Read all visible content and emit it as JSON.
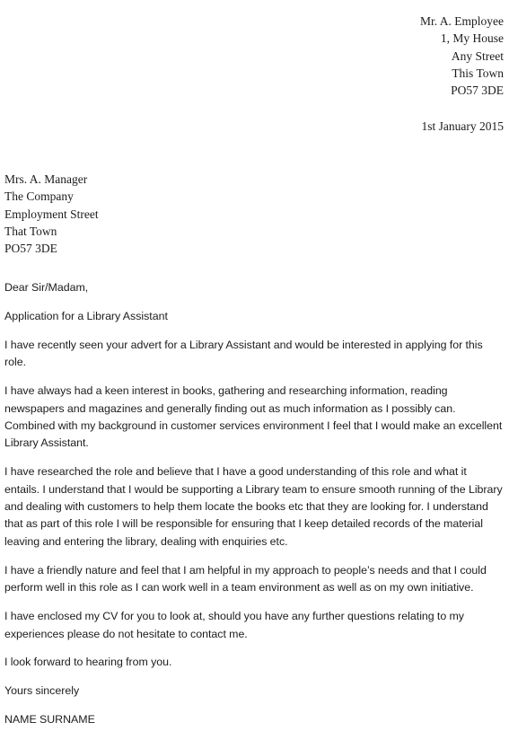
{
  "document": {
    "type": "cover-letter",
    "background_color": "#ffffff",
    "text_color": "#1c1c1c",
    "sender": {
      "lines": [
        "Mr. A. Employee",
        "1, My House",
        "Any Street",
        "This Town",
        "PO57 3DE"
      ]
    },
    "date": "1st January 2015",
    "recipient": {
      "lines": [
        "Mrs. A. Manager",
        "The Company",
        "Employment Street",
        "That Town",
        "PO57 3DE"
      ]
    },
    "salutation": "Dear Sir/Madam,",
    "subject": "Application for a Library Assistant",
    "paragraphs": [
      "I have recently seen your advert for a Library Assistant and would be interested in applying for this role.",
      "I have always had a keen interest in books, gathering and researching information, reading newspapers and magazines and generally finding out as much information as I possibly can.  Combined with my background in customer services environment I feel that I would make an excellent Library Assistant.",
      "I have researched the role and believe that I have a good understanding of this role and what it entails. I understand that I would be supporting a Library team to ensure smooth running of the Library and dealing with customers to help them locate the books etc that they are looking for.  I understand that as part of this role I will be responsible for ensuring that I keep detailed records of the material leaving and entering the library, dealing with enquiries etc.",
      "I have a friendly nature and feel that I am helpful in my approach to people’s needs and that I could perform well in this role as I can work well in a team environment as well as on my own initiative.",
      "I have enclosed my CV for you to look at, should you have any further questions relating to my experiences please do not hesitate to contact me.",
      "I look forward to hearing from you."
    ],
    "sign_off": "Yours sincerely",
    "signature_name": "NAME SURNAME"
  }
}
